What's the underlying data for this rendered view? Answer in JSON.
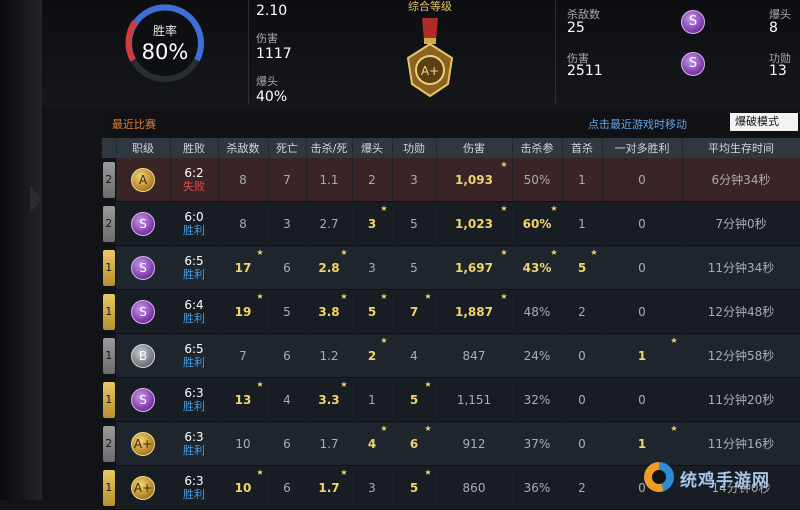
{
  "summary": {
    "win_rate_label": "胜率",
    "win_rate_value": "80%",
    "kd_value": "2.10",
    "damage_label": "伤害",
    "damage_value": "1117",
    "headshot_label": "爆头",
    "headshot_value": "40%",
    "rank_title": "综合等级",
    "rank_grade": "A+",
    "kills_label": "杀敌数",
    "kills_value": "25",
    "recent_damage_label": "伤害",
    "recent_damage_value": "2511",
    "recent_headshot_label": "爆头",
    "recent_headshot_value": "8",
    "assist_label": "功勋",
    "assist_value": "13",
    "s_badge": "S"
  },
  "section": {
    "title": "最近比赛",
    "link": "点击最近游戏时移动",
    "mode_selected": "爆破模式"
  },
  "table": {
    "headers": [
      "",
      "职级",
      "胜败",
      "杀敌数",
      "死亡",
      "击杀/死",
      "爆头",
      "功勋",
      "伤害",
      "击杀参",
      "首杀",
      "一对多胜利",
      "平均生存时间"
    ],
    "rows": [
      {
        "num": "2",
        "num_color": "gray",
        "grade": "A",
        "score": "6:2",
        "result": "失败",
        "win": false,
        "kills": "8",
        "deaths": "7",
        "kd": "1.1",
        "hs": "2",
        "assist": "3",
        "damage": "1,093",
        "part": "50%",
        "first": "1",
        "clutch": "0",
        "survive": "6分钟34秒",
        "hl": {
          "damage": true
        }
      },
      {
        "num": "2",
        "num_color": "gray",
        "grade": "S",
        "score": "6:0",
        "result": "胜利",
        "win": true,
        "kills": "8",
        "deaths": "3",
        "kd": "2.7",
        "hs": "3",
        "assist": "5",
        "damage": "1,023",
        "part": "60%",
        "first": "1",
        "clutch": "0",
        "survive": "7分钟0秒",
        "hl": {
          "hs": true,
          "damage": true,
          "part": true
        }
      },
      {
        "num": "1",
        "num_color": "gold",
        "grade": "S",
        "score": "6:5",
        "result": "胜利",
        "win": true,
        "kills": "17",
        "deaths": "6",
        "kd": "2.8",
        "hs": "3",
        "assist": "5",
        "damage": "1,697",
        "part": "43%",
        "first": "5",
        "clutch": "0",
        "survive": "11分钟34秒",
        "hl": {
          "kills": true,
          "kd": true,
          "damage": true,
          "part": true,
          "first": true
        }
      },
      {
        "num": "1",
        "num_color": "gold",
        "grade": "S",
        "score": "6:4",
        "result": "胜利",
        "win": true,
        "kills": "19",
        "deaths": "5",
        "kd": "3.8",
        "hs": "5",
        "assist": "7",
        "damage": "1,887",
        "part": "48%",
        "first": "2",
        "clutch": "0",
        "survive": "12分钟48秒",
        "hl": {
          "kills": true,
          "kd": true,
          "hs": true,
          "assist": true,
          "damage": true
        }
      },
      {
        "num": "1",
        "num_color": "gray",
        "grade": "B",
        "score": "6:5",
        "result": "胜利",
        "win": true,
        "kills": "7",
        "deaths": "6",
        "kd": "1.2",
        "hs": "2",
        "assist": "4",
        "damage": "847",
        "part": "24%",
        "first": "0",
        "clutch": "1",
        "survive": "12分钟58秒",
        "hl": {
          "hs": true,
          "clutch": true
        }
      },
      {
        "num": "1",
        "num_color": "gold",
        "grade": "S",
        "score": "6:3",
        "result": "胜利",
        "win": true,
        "kills": "13",
        "deaths": "4",
        "kd": "3.3",
        "hs": "1",
        "assist": "5",
        "damage": "1,151",
        "part": "32%",
        "first": "0",
        "clutch": "0",
        "survive": "11分钟20秒",
        "hl": {
          "kills": true,
          "kd": true,
          "assist": true
        }
      },
      {
        "num": "2",
        "num_color": "gray",
        "grade": "A+",
        "score": "6:3",
        "result": "胜利",
        "win": true,
        "kills": "10",
        "deaths": "6",
        "kd": "1.7",
        "hs": "4",
        "assist": "6",
        "damage": "912",
        "part": "37%",
        "first": "0",
        "clutch": "1",
        "survive": "11分钟16秒",
        "hl": {
          "hs": true,
          "assist": true,
          "clutch": true
        }
      },
      {
        "num": "1",
        "num_color": "gold",
        "grade": "A+",
        "score": "6:3",
        "result": "胜利",
        "win": true,
        "kills": "10",
        "deaths": "6",
        "kd": "1.7",
        "hs": "3",
        "assist": "5",
        "damage": "860",
        "part": "36%",
        "first": "2",
        "clutch": "0",
        "survive": "14分钟0秒",
        "hl": {
          "kills": true,
          "kd": true,
          "assist": true
        }
      }
    ]
  },
  "watermark": "统鸡手游网",
  "colors": {
    "accent_orange": "#e0803a",
    "link_blue": "#5fa4e8",
    "win_blue": "#4a9fe6",
    "loss_red": "#e05050",
    "highlight_gold": "#f1d46a"
  }
}
